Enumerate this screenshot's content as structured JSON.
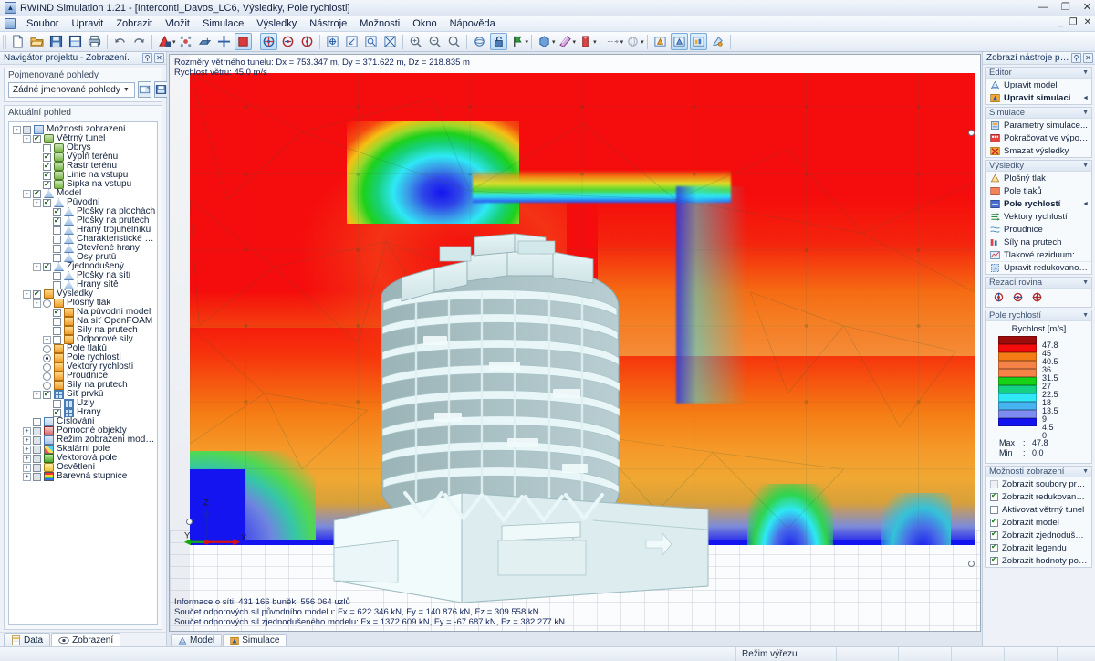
{
  "window": {
    "title": "RWIND Simulation 1.21 - [Interconti_Davos_LC6, Výsledky, Pole rychlosti]",
    "minimize": "—",
    "maximize": "❐",
    "close": "✕",
    "doc_minimize": "_",
    "doc_restore": "❐",
    "doc_close": "✕"
  },
  "menu": {
    "items": [
      "Soubor",
      "Upravit",
      "Zobrazit",
      "Vložit",
      "Simulace",
      "Výsledky",
      "Nástroje",
      "Možnosti",
      "Okno",
      "Nápověda"
    ]
  },
  "toolbar": {
    "groups": [
      [
        "new-file-icon",
        "open-folder-icon",
        "save-icon",
        "save-as-icon",
        "print-icon"
      ],
      [
        "undo-icon",
        "redo-icon"
      ],
      [
        "render-icon",
        "select-icon",
        "move-icon",
        "snap-icon",
        "stop-icon"
      ],
      [
        "wind-tunnel-icon",
        "wind-tunnel-2-icon",
        "wind-tunnel-3-icon"
      ],
      [
        "view-iso-icon",
        "view-front-icon",
        "view-zoom-icon",
        "view-fit-icon"
      ],
      [
        "zoom-in-icon",
        "zoom-out-icon",
        "zoom-prev-icon"
      ],
      [
        "rotate-icon",
        "unlock-icon",
        "flag-icon"
      ],
      [
        "solid-icon",
        "transparent-icon",
        "clip-icon"
      ],
      [
        "dim-icon",
        "sphere-icon"
      ],
      [
        "model-view-icon",
        "model-sim-icon",
        "results-view-icon",
        "render-opt-icon"
      ]
    ]
  },
  "navigator": {
    "header": "Navigátor projektu - Zobrazení.",
    "named_views_label": "Pojmenované pohledy",
    "named_views_value": "Žádné jmenované pohledy",
    "current_view_label": "Aktuální pohled",
    "tree": [
      {
        "label": "Možnosti zobrazení",
        "depth": 0,
        "ctrl": "none",
        "exp": "-",
        "icon": "ic-disp",
        "bold": false
      },
      {
        "label": "Větrný tunel",
        "depth": 1,
        "ctrl": "cb-on",
        "exp": "-",
        "icon": "ic-tunnel",
        "bold": false
      },
      {
        "label": "Obrys",
        "depth": 2,
        "ctrl": "cb-off",
        "exp": "",
        "icon": "ic-tunnel",
        "bold": false
      },
      {
        "label": "Výplň terénu",
        "depth": 2,
        "ctrl": "cb-on",
        "exp": "",
        "icon": "ic-tunnel",
        "bold": false
      },
      {
        "label": "Rastr terénu",
        "depth": 2,
        "ctrl": "cb-on",
        "exp": "",
        "icon": "ic-tunnel",
        "bold": false
      },
      {
        "label": "Linie na vstupu",
        "depth": 2,
        "ctrl": "cb-on",
        "exp": "",
        "icon": "ic-tunnel",
        "bold": false
      },
      {
        "label": "Šipka na vstupu",
        "depth": 2,
        "ctrl": "cb-on",
        "exp": "",
        "icon": "ic-tunnel",
        "bold": false
      },
      {
        "label": "Model",
        "depth": 1,
        "ctrl": "cb-on",
        "exp": "-",
        "icon": "ic-model",
        "bold": false
      },
      {
        "label": "Původní",
        "depth": 2,
        "ctrl": "cb-on",
        "exp": "-",
        "icon": "ic-model",
        "bold": false
      },
      {
        "label": "Plošky na plochách",
        "depth": 3,
        "ctrl": "cb-on",
        "exp": "",
        "icon": "ic-model",
        "bold": false
      },
      {
        "label": "Plošky na prutech",
        "depth": 3,
        "ctrl": "cb-on",
        "exp": "",
        "icon": "ic-model",
        "bold": false
      },
      {
        "label": "Hrany trojúhelníku",
        "depth": 3,
        "ctrl": "cb-off",
        "exp": "",
        "icon": "ic-model",
        "bold": false
      },
      {
        "label": "Charakteristické hrany",
        "depth": 3,
        "ctrl": "cb-off",
        "exp": "",
        "icon": "ic-model",
        "bold": false
      },
      {
        "label": "Otevřené hrany",
        "depth": 3,
        "ctrl": "cb-off",
        "exp": "",
        "icon": "ic-model",
        "bold": false
      },
      {
        "label": "Osy prutů",
        "depth": 3,
        "ctrl": "cb-off",
        "exp": "",
        "icon": "ic-model",
        "bold": false
      },
      {
        "label": "Zjednodušený",
        "depth": 2,
        "ctrl": "cb-on",
        "exp": "-",
        "icon": "ic-model",
        "bold": false
      },
      {
        "label": "Plošky na síti",
        "depth": 3,
        "ctrl": "cb-off",
        "exp": "",
        "icon": "ic-model",
        "bold": false
      },
      {
        "label": "Hrany sítě",
        "depth": 3,
        "ctrl": "cb-off",
        "exp": "",
        "icon": "ic-model",
        "bold": false
      },
      {
        "label": "Výsledky",
        "depth": 1,
        "ctrl": "cb-on",
        "exp": "-",
        "icon": "ic-res",
        "bold": false
      },
      {
        "label": "Plošný tlak",
        "depth": 2,
        "ctrl": "rad-off",
        "exp": "-",
        "icon": "ic-res",
        "bold": false
      },
      {
        "label": "Na původní model",
        "depth": 3,
        "ctrl": "cb-on",
        "exp": "",
        "icon": "ic-res",
        "bold": false
      },
      {
        "label": "Na síť OpenFOAM",
        "depth": 3,
        "ctrl": "cb-off",
        "exp": "",
        "icon": "ic-res",
        "bold": false
      },
      {
        "label": "Síly na prutech",
        "depth": 3,
        "ctrl": "cb-off",
        "exp": "",
        "icon": "ic-res",
        "bold": false
      },
      {
        "label": "Odporové síly",
        "depth": 3,
        "ctrl": "cb-off",
        "exp": "+",
        "icon": "ic-res",
        "bold": false
      },
      {
        "label": "Pole tlaků",
        "depth": 2,
        "ctrl": "rad-off",
        "exp": "",
        "icon": "ic-res",
        "bold": false
      },
      {
        "label": "Pole rychlostí",
        "depth": 2,
        "ctrl": "rad-on",
        "exp": "",
        "icon": "ic-res",
        "bold": false
      },
      {
        "label": "Vektory rychlostí",
        "depth": 2,
        "ctrl": "rad-off",
        "exp": "",
        "icon": "ic-res",
        "bold": false
      },
      {
        "label": "Proudnice",
        "depth": 2,
        "ctrl": "rad-off",
        "exp": "",
        "icon": "ic-res",
        "bold": false
      },
      {
        "label": "Síly na prutech",
        "depth": 2,
        "ctrl": "rad-off",
        "exp": "",
        "icon": "ic-res",
        "bold": false
      },
      {
        "label": "Síť prvků",
        "depth": 2,
        "ctrl": "cb-on",
        "exp": "-",
        "icon": "ic-mesh",
        "bold": false
      },
      {
        "label": "Uzly",
        "depth": 3,
        "ctrl": "cb-off",
        "exp": "",
        "icon": "ic-mesh",
        "bold": false
      },
      {
        "label": "Hrany",
        "depth": 3,
        "ctrl": "cb-on",
        "exp": "",
        "icon": "ic-mesh",
        "bold": false
      },
      {
        "label": "Číslování",
        "depth": 1,
        "ctrl": "cb-off",
        "exp": "",
        "icon": "ic-num",
        "bold": false
      },
      {
        "label": "Pomocné objekty",
        "depth": 1,
        "ctrl": "cb-gray",
        "exp": "+",
        "icon": "ic-aux",
        "bold": false
      },
      {
        "label": "Režim zobrazení modelu",
        "depth": 1,
        "ctrl": "cb-gray",
        "exp": "+",
        "icon": "ic-disp",
        "bold": false
      },
      {
        "label": "Skalární pole",
        "depth": 1,
        "ctrl": "cb-gray",
        "exp": "+",
        "icon": "ic-scal",
        "bold": false
      },
      {
        "label": "Vektorová pole",
        "depth": 1,
        "ctrl": "cb-gray",
        "exp": "+",
        "icon": "ic-vect",
        "bold": false
      },
      {
        "label": "Osvětlení",
        "depth": 1,
        "ctrl": "cb-gray",
        "exp": "+",
        "icon": "ic-light",
        "bold": false
      },
      {
        "label": "Barevná stupnice",
        "depth": 1,
        "ctrl": "cb-gray",
        "exp": "+",
        "icon": "ic-scale",
        "bold": false
      }
    ],
    "tabs": [
      {
        "label": "Data",
        "icon": "data-icon",
        "selected": false
      },
      {
        "label": "Zobrazení",
        "icon": "eye-icon",
        "selected": true
      }
    ]
  },
  "viewport": {
    "info_top": [
      "Rozměry větrného tunelu: Dx = 753.347 m, Dy = 371.622 m, Dz = 218.835 m",
      "Rychlost větru: 45.0 m/s"
    ],
    "info_bottom": [
      "Informace o síti: 431 166 buněk, 556 064 uzlů",
      "Součet odporových sil původního modelu: Fx = 622.346 kN, Fy = 140.876 kN, Fz = 309.558 kN",
      "Součet odporových sil zjednodušeného modelu: Fx = 1372.609 kN, Fy = -67.687 kN, Fz = 382.277 kN"
    ],
    "axes": {
      "x": "X",
      "y": "Y",
      "z": "Z"
    },
    "tabs": [
      {
        "label": "Model",
        "icon": "model-icon",
        "selected": false
      },
      {
        "label": "Simulace",
        "icon": "simulation-icon",
        "selected": true
      }
    ]
  },
  "rightpanel": {
    "header": "Zobrazí nástroje pro úpravy - Si...",
    "sections": [
      {
        "title": "Editor",
        "items": [
          {
            "label": "Upravit model",
            "icon": "model-icon",
            "bold": false,
            "mark": ""
          },
          {
            "label": "Upravit simulaci",
            "icon": "simulation-icon",
            "bold": true,
            "mark": "◄"
          }
        ]
      },
      {
        "title": "Simulace",
        "items": [
          {
            "label": "Parametry simulace...",
            "icon": "parameters-icon",
            "bold": false,
            "mark": ""
          },
          {
            "label": "Pokračovat ve výpočtu",
            "icon": "continue-calc-icon",
            "bold": false,
            "mark": ""
          },
          {
            "label": "Smazat výsledky",
            "icon": "delete-results-icon",
            "bold": false,
            "mark": ""
          }
        ]
      },
      {
        "title": "Výsledky",
        "items": [
          {
            "label": "Plošný tlak",
            "icon": "surface-pressure-icon",
            "bold": false,
            "mark": ""
          },
          {
            "label": "Pole tlaků",
            "icon": "pressure-field-icon",
            "bold": false,
            "mark": ""
          },
          {
            "label": "Pole rychlostí",
            "icon": "velocity-field-icon",
            "bold": true,
            "mark": "◄"
          },
          {
            "label": "Vektory rychlostí",
            "icon": "velocity-vectors-icon",
            "bold": false,
            "mark": ""
          },
          {
            "label": "Proudnice",
            "icon": "streamlines-icon",
            "bold": false,
            "mark": ""
          },
          {
            "label": "Síly na prutech",
            "icon": "member-forces-icon",
            "bold": false,
            "mark": ""
          },
          {
            "label": "Tlakové reziduum:",
            "icon": "residuum-icon",
            "bold": false,
            "mark": ""
          },
          {
            "label": "Upravit redukovanou oblast",
            "icon": "reduced-area-icon",
            "bold": false,
            "mark": ""
          }
        ]
      },
      {
        "title": "Řezací rovina",
        "icons": [
          "section-plane-1-icon",
          "section-plane-2-icon",
          "section-plane-3-icon"
        ]
      },
      {
        "title": "Pole rychlostí"
      },
      {
        "title": "Možnosti zobrazení",
        "checks": [
          {
            "label": "Zobrazit soubory protokolu",
            "checked": "disabled"
          },
          {
            "label": "Zobrazit redukovanou oblast",
            "checked": "on"
          },
          {
            "label": "Aktivovat větrný tunel",
            "checked": "off"
          },
          {
            "label": "Zobrazit model",
            "checked": "on"
          },
          {
            "label": "Zobrazit zjednodušený model",
            "checked": "on"
          },
          {
            "label": "Zobrazit legendu",
            "checked": "on"
          },
          {
            "label": "Zobrazit hodnoty pod kurzorem",
            "checked": "on"
          }
        ]
      }
    ]
  },
  "chart_data": {
    "type": "heatmap",
    "title": "Rychlost [m/s]",
    "legend_title": "Rychlost [m/s]",
    "unit": "m/s",
    "values": [
      47.8,
      45.0,
      40.5,
      36.0,
      31.5,
      27.0,
      22.5,
      18.0,
      13.5,
      9.0,
      4.5,
      0.0
    ],
    "colors": [
      "#9e0b0b",
      "#f50c0c",
      "#f57c14",
      "#f58246",
      "#f58246",
      "#17d117",
      "#14d183",
      "#2ee8f5",
      "#46b4f0",
      "#7c8cf0",
      "#1414f0"
    ],
    "max_label": "Max",
    "min_label": "Min",
    "separator": ":",
    "max_value": "47.8",
    "min_value": "0.0"
  },
  "statusbar": {
    "left": "",
    "cells": [
      "Režim výřezu",
      "",
      "",
      "",
      "",
      ""
    ]
  }
}
